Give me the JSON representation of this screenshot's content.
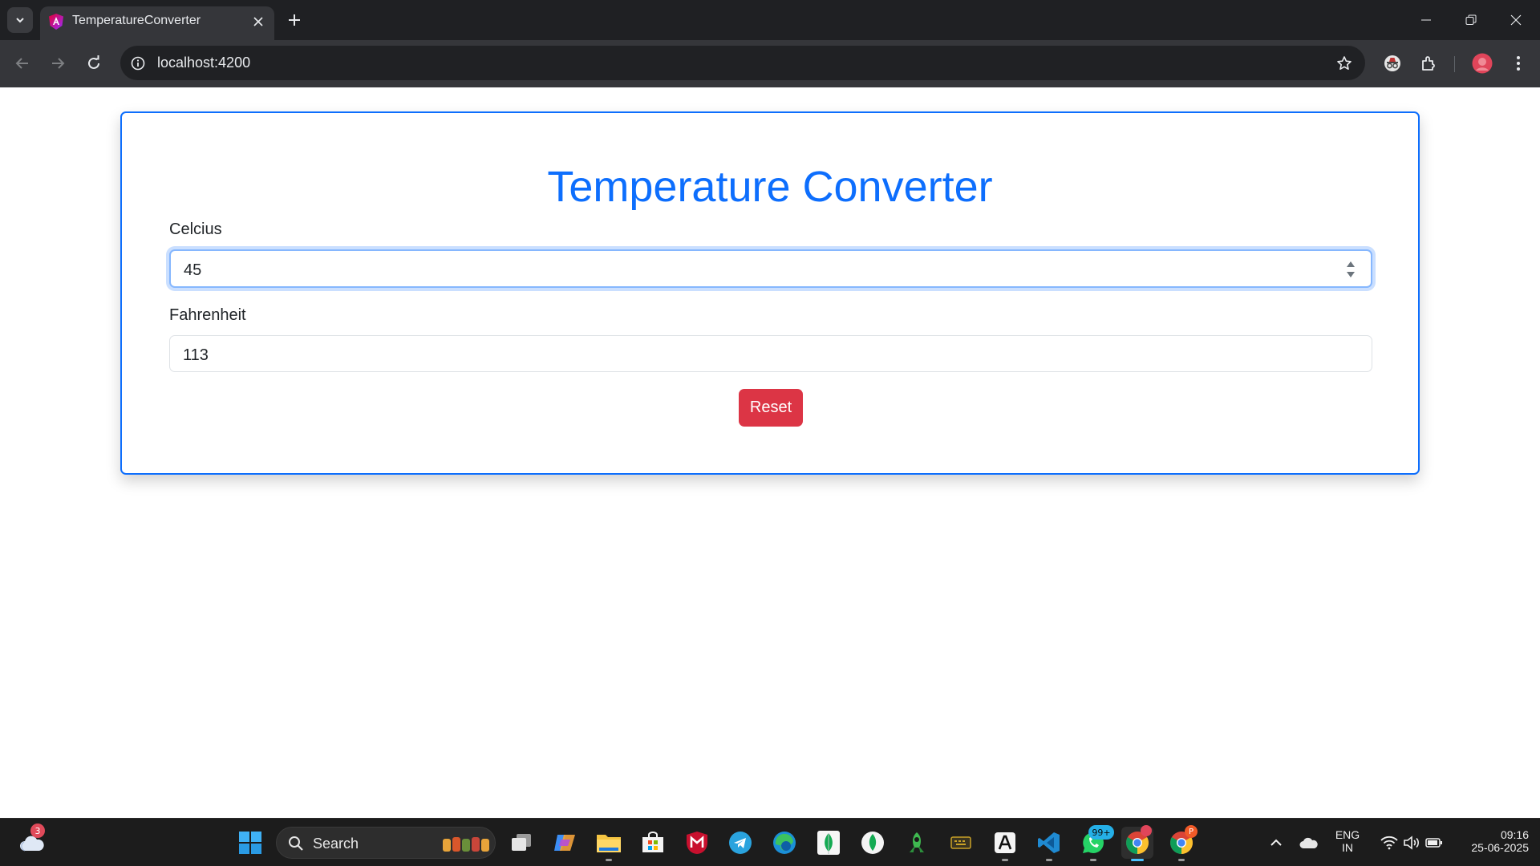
{
  "browser": {
    "tab_title": "TemperatureConverter",
    "url": "localhost:4200"
  },
  "app": {
    "title": "Temperature Converter",
    "celsius_label": "Celcius",
    "celsius_value": "45",
    "fahrenheit_label": "Fahrenheit",
    "fahrenheit_value": "113",
    "reset_label": "Reset"
  },
  "taskbar": {
    "weather_badge": "3",
    "search_label": "Search",
    "whatsapp_badge": "99+",
    "chrome_profile_badge": "P",
    "language_top": "ENG",
    "language_bottom": "IN",
    "time": "09:16",
    "date": "25-06-2025"
  },
  "colors": {
    "primary": "#0d6efd",
    "danger": "#dc3545",
    "chrome_dark": "#35363a",
    "taskbar": "#1c1c1c"
  },
  "icons": [
    "tab-list-icon",
    "angular-favicon-icon",
    "close-icon",
    "plus-icon",
    "minimize-icon",
    "restore-icon",
    "window-close-icon",
    "back-icon",
    "forward-icon",
    "reload-icon",
    "info-icon",
    "star-icon",
    "incognito-icon",
    "extensions-icon",
    "profile-avatar-icon",
    "kebab-menu-icon"
  ]
}
